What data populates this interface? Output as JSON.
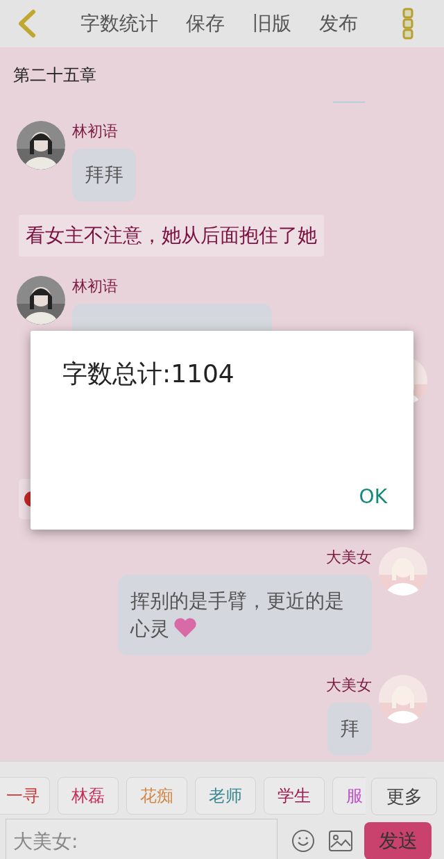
{
  "top_bar": {
    "actions": [
      "字数统计",
      "保存",
      "旧版",
      "发布"
    ]
  },
  "chapter_title": "第二十五章",
  "messages": [
    {
      "kind": "left",
      "name": "林初语",
      "text": "拜拜"
    },
    {
      "kind": "narration",
      "text": "看女主不注意，她从后面抱住了她"
    },
    {
      "kind": "left",
      "name": "林初语"
    },
    {
      "kind": "right"
    },
    {
      "kind": "fragment"
    },
    {
      "kind": "right",
      "name": "大美女",
      "text": "挥别的是手臂，更近的是心灵",
      "sticker": true
    },
    {
      "kind": "right",
      "name": "大美女",
      "text": "拜"
    }
  ],
  "roles": [
    {
      "label": "一寻",
      "color": "#c8383a"
    },
    {
      "label": "林磊",
      "color": "#c03058"
    },
    {
      "label": "花痴",
      "color": "#d08848"
    },
    {
      "label": "老师",
      "color": "#3a8890"
    },
    {
      "label": "学生",
      "color": "#a01850"
    },
    {
      "label": "服",
      "color": "#c050c8"
    }
  ],
  "more_button": "更多",
  "input": {
    "placeholder": "大美女:"
  },
  "send_button": "发送",
  "dialog": {
    "message": "字数总计:1104",
    "button": "OK"
  }
}
